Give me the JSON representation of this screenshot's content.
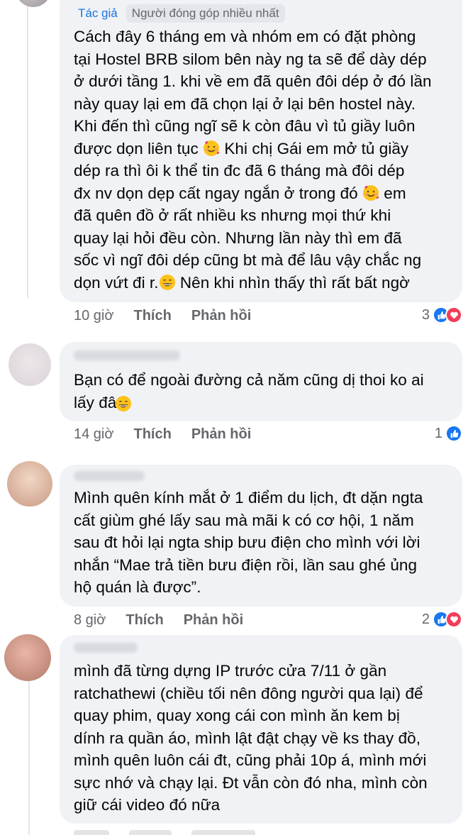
{
  "comment1": {
    "author_badge": "Tác giả",
    "top_badge": "Người đóng góp nhiều nhất",
    "text_parts": [
      "Cách đây 6 tháng em và  nhóm em có đặt phòng\ntại Hostel BRB silom bên này ng ta sẽ để dày dép\nở dưới tầng 1. khi về em đã quên đôi dép ở đó lần\nnày quay lại em đã chọn lại ở lại bên hostel này.\nKhi đến thì cũng ngĩ sẽ k còn đâu vì tủ giầy luôn\nđược dọn liên tục ",
      " Khi chị Gái em mở tủ giầy\ndép ra thì ôi k thể tin đc đã 6 tháng mà đôi dép\nđx nv dọn dẹp cất ngay ngắn ở trong đó ",
      " em\nđã quên đồ ở rất nhiều ks nhưng mọi thứ khi\nquay lại hỏi đều còn. Nhưng lần này thì em đã\nsốc vì ngĩ đôi dép cũng bt mà để lâu vậy chắc ng\ndọn vứt đi r.",
      " Nên khi nhìn thấy thì rất bất ngờ"
    ],
    "time": "10 giờ",
    "like": "Thích",
    "reply": "Phản hồi",
    "reaction_count": "3"
  },
  "comment2": {
    "text": "Bạn có để ngoài đường cả năm cũng dị thoi ko ai\nlấy đâu",
    "time": "14 giờ",
    "like": "Thích",
    "reply": "Phản hồi",
    "reaction_count": "1"
  },
  "comment3": {
    "text": "Mình quên kính mắt ở 1 điểm du lịch, đt dặn ngta\ncất giùm ghé lấy sau mà mãi k có cơ hội, 1 năm\nsau đt hỏi lại ngta ship bưu điện cho mình với lời\nnhắn “Mae trả tiền bưu điện rồi, lần sau ghé ủng\nhộ quán là được”.",
    "time": "8 giờ",
    "like": "Thích",
    "reply": "Phản hồi",
    "reaction_count": "2"
  },
  "comment4": {
    "text": "mình đã từng dựng IP trước cửa 7/11 ở gần\nratchathewi (chiều tối nên đông người qua lại) để\nquay phim, quay xong cái con mình ăn kem bị\ndính ra quần áo, mình lật đật chạy về ks thay đồ,\nmình quên luôn cái đt, cũng phải 10p á, mình mới\nsực nhớ và chạy lại. Đt vẫn còn đó nha, mình còn\ngiữ cái video đó nữa"
  },
  "colors": {
    "bubble": "#f0f2f5",
    "link_blue": "#1b74e4",
    "like_blue": "#1877f2",
    "love_red": "#f33e58",
    "meta_gray": "#65676b"
  },
  "icons": [
    "like-reaction-icon",
    "love-reaction-icon",
    "smiling-face-hearts-emoji-icon",
    "grinning-face-emoji-icon"
  ]
}
